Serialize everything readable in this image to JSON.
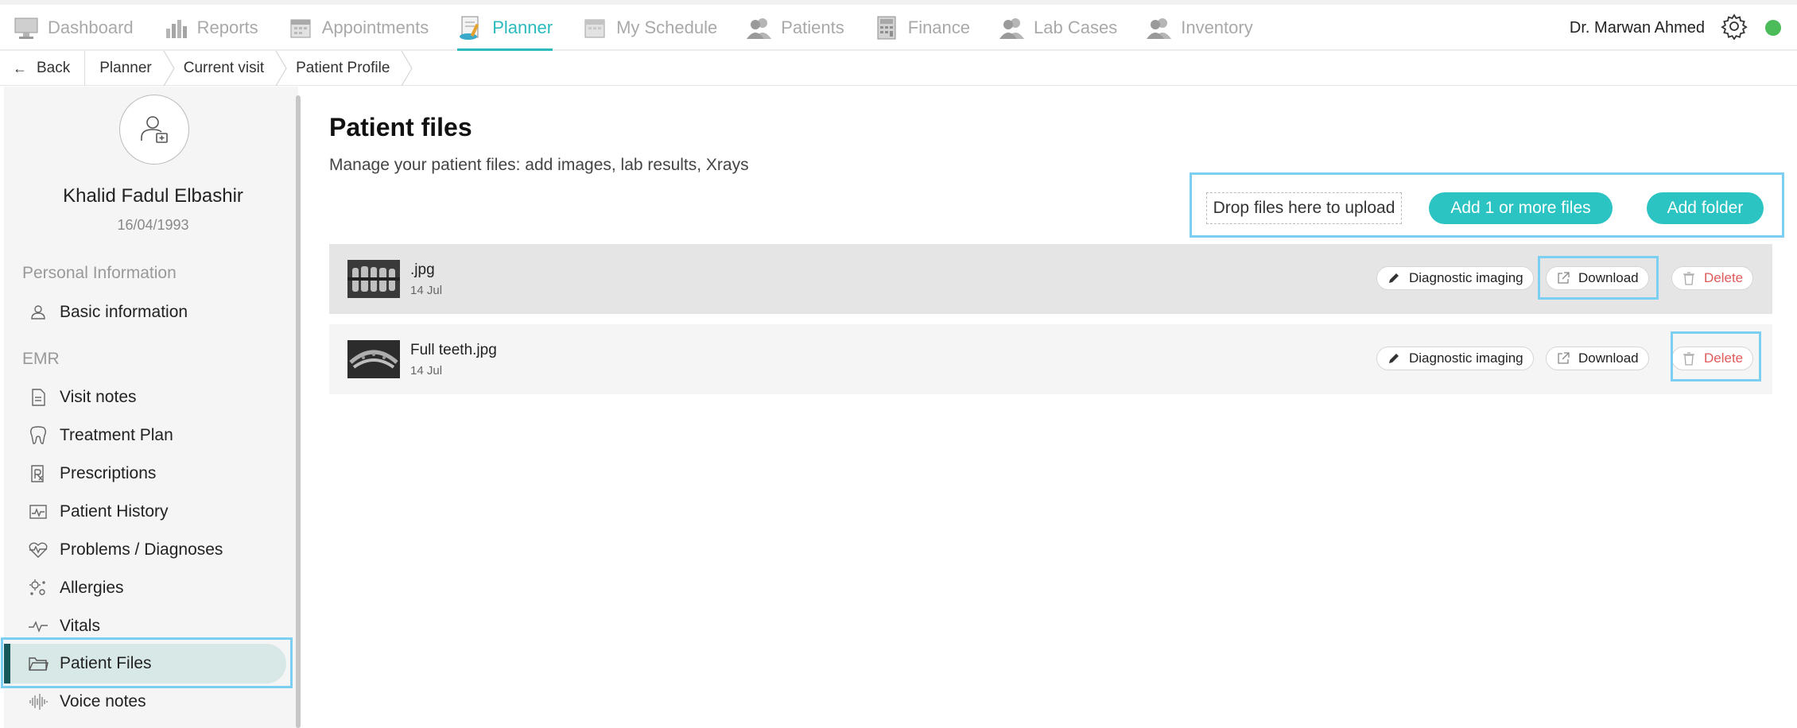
{
  "nav": {
    "items": [
      {
        "label": "Dashboard",
        "icon": "monitor-icon"
      },
      {
        "label": "Reports",
        "icon": "bar-chart-icon"
      },
      {
        "label": "Appointments",
        "icon": "calendar-icon"
      },
      {
        "label": "Planner",
        "icon": "planner-icon",
        "active": true
      },
      {
        "label": "My Schedule",
        "icon": "schedule-icon"
      },
      {
        "label": "Patients",
        "icon": "users-icon"
      },
      {
        "label": "Finance",
        "icon": "calculator-icon"
      },
      {
        "label": "Lab Cases",
        "icon": "users-icon"
      },
      {
        "label": "Inventory",
        "icon": "users-icon"
      }
    ],
    "user_name": "Dr. Marwan Ahmed",
    "accent_color": "#2bbbbd",
    "status_color": "#4cbb5a"
  },
  "breadcrumb": {
    "back": "Back",
    "items": [
      "Planner",
      "Current visit",
      "Patient Profile"
    ]
  },
  "sidebar": {
    "patient_name": "Khalid Fadul Elbashir",
    "patient_dob": "16/04/1993",
    "personal_label": "Personal Information",
    "basic_info": "Basic information",
    "emr_label": "EMR",
    "emr_items": [
      {
        "label": "Visit notes",
        "icon": "document-icon"
      },
      {
        "label": "Treatment Plan",
        "icon": "tooth-icon"
      },
      {
        "label": "Prescriptions",
        "icon": "prescription-icon"
      },
      {
        "label": "Patient History",
        "icon": "history-chart-icon"
      },
      {
        "label": "Problems / Diagnoses",
        "icon": "diagnosis-icon"
      },
      {
        "label": "Allergies",
        "icon": "allergy-icon"
      },
      {
        "label": "Vitals",
        "icon": "pulse-icon"
      },
      {
        "label": "Patient Files",
        "icon": "folder-icon",
        "active": true
      },
      {
        "label": "Voice notes",
        "icon": "waveform-icon"
      }
    ],
    "active_color": "#17595a"
  },
  "main": {
    "title": "Patient files",
    "subtitle": "Manage your patient files: add images, lab results, Xrays",
    "drop_zone": "Drop files here to upload",
    "add_files_button": "Add 1 or more files",
    "add_folder_button": "Add folder",
    "files": [
      {
        "name": ".jpg",
        "date": "14 Jul",
        "category": "Diagnostic imaging",
        "download": "Download",
        "delete": "Delete"
      },
      {
        "name": "Full teeth.jpg",
        "date": "14 Jul",
        "category": "Diagnostic imaging",
        "download": "Download",
        "delete": "Delete"
      }
    ],
    "button_color": "#2cc3c3",
    "delete_color": "#e05a5a",
    "highlight_color": "#7dcff2"
  }
}
